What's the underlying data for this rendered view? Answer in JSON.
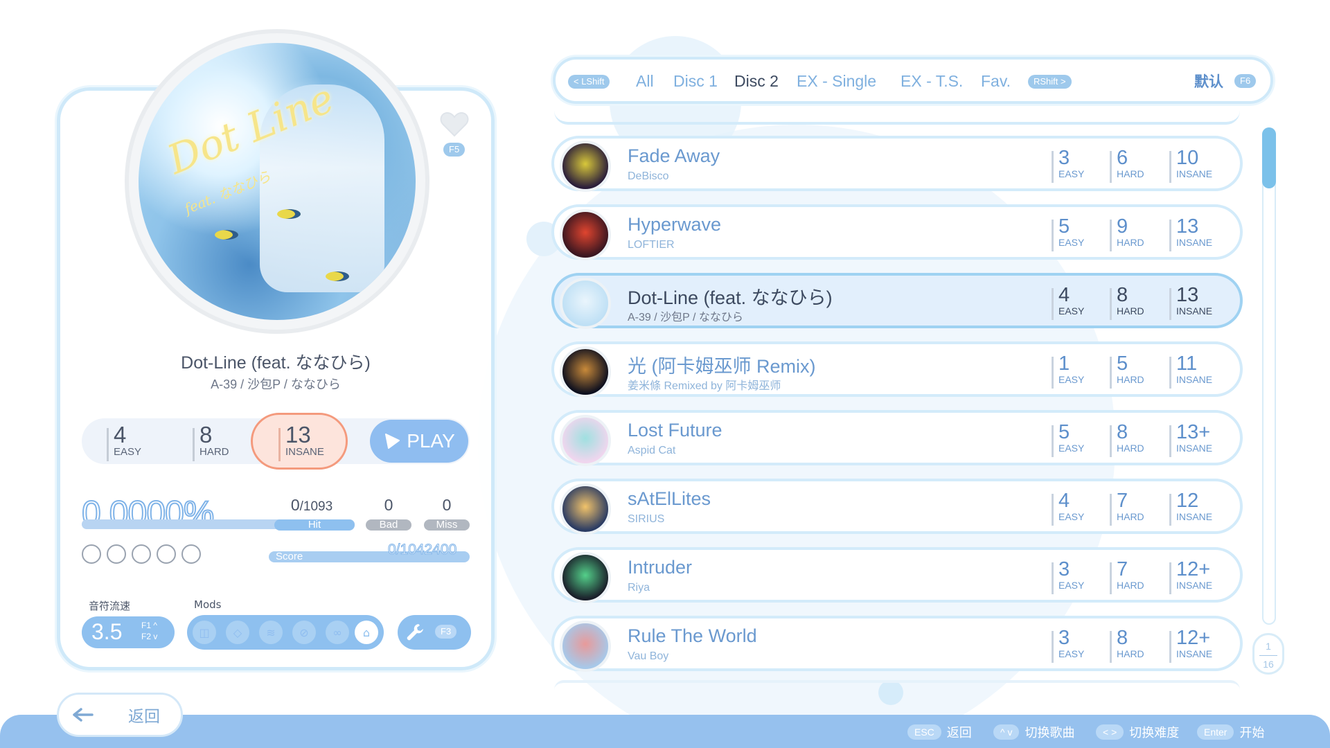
{
  "nav": {
    "prev_key": "< LShift",
    "next_key": "RShift >",
    "tabs": [
      {
        "label": "All",
        "active": false
      },
      {
        "label": "Disc 1",
        "active": false
      },
      {
        "label": "Disc 2",
        "active": true
      },
      {
        "label": "EX - Single",
        "active": false
      },
      {
        "label": "EX - T.S.",
        "active": false
      },
      {
        "label": "Fav.",
        "active": false
      }
    ],
    "sort_label": "默认",
    "sort_key": "F6"
  },
  "detail": {
    "favorite_key": "F5",
    "title": "Dot-Line (feat. ななひら)",
    "artist": "A-39 / 沙包P / ななひら",
    "cover_text": "Dot Line",
    "cover_sub": "feat. ななひら",
    "difficulties": [
      {
        "level": "4",
        "name": "EASY"
      },
      {
        "level": "8",
        "name": "HARD"
      },
      {
        "level": "13",
        "name": "INSANE"
      }
    ],
    "selected_difficulty": "INSANE",
    "play_label": "PLAY",
    "accuracy": "0.0000%",
    "hit_value": "0",
    "hit_total": "/1093",
    "hit_label": "Hit",
    "bad_value": "0",
    "bad_label": "Bad",
    "miss_value": "0",
    "miss_label": "Miss",
    "score_label": "Score",
    "score_value": "0/1042400",
    "rating_circles": 5,
    "speed_label": "音符流速",
    "speed_value": "3.5",
    "speed_up_key": "F1 ^",
    "speed_down_key": "F2 v",
    "mods_label": "Mods",
    "settings_key": "F3"
  },
  "songs": [
    {
      "title": "Fade Away",
      "artist": "DeBisco",
      "easy": "3",
      "hard": "6",
      "insane": "10",
      "selected": false,
      "cover": [
        "#2a1d3a",
        "#d8c83a"
      ]
    },
    {
      "title": "Hyperwave",
      "artist": "LOFTIER",
      "easy": "5",
      "hard": "9",
      "insane": "13",
      "selected": false,
      "cover": [
        "#3a1620",
        "#e0452f"
      ]
    },
    {
      "title": "Dot-Line (feat. ななひら)",
      "artist": "A-39 / 沙包P / ななひら",
      "easy": "4",
      "hard": "8",
      "insane": "13",
      "selected": true,
      "cover": [
        "#bfe0f5",
        "#eaf5fc"
      ]
    },
    {
      "title": "光 (阿卡姆巫师 Remix)",
      "artist": "姜米條 Remixed by 阿卡姆巫师",
      "easy": "1",
      "hard": "5",
      "insane": "11",
      "selected": false,
      "cover": [
        "#0d0f1e",
        "#c98a3a"
      ]
    },
    {
      "title": "Lost Future",
      "artist": "Aspid Cat",
      "easy": "5",
      "hard": "8",
      "insane": "13+",
      "selected": false,
      "cover": [
        "#f0d6ee",
        "#9fe0e0"
      ]
    },
    {
      "title": "sAtElLites",
      "artist": "SIRIUS",
      "easy": "4",
      "hard": "7",
      "insane": "12",
      "selected": false,
      "cover": [
        "#2a3b63",
        "#f2c36a"
      ]
    },
    {
      "title": "Intruder",
      "artist": "Riya",
      "easy": "3",
      "hard": "7",
      "insane": "12+",
      "selected": false,
      "cover": [
        "#1a1f2a",
        "#54d08a"
      ]
    },
    {
      "title": "Rule The World",
      "artist": "Vau Boy",
      "easy": "3",
      "hard": "8",
      "insane": "12+",
      "selected": false,
      "cover": [
        "#a7c8e9",
        "#e89a9a"
      ]
    }
  ],
  "diff_labels": {
    "easy": "EASY",
    "hard": "HARD",
    "insane": "INSANE"
  },
  "page": {
    "current": "1",
    "total": "16"
  },
  "footer": {
    "back_label": "返回",
    "hints": [
      {
        "key": "ESC",
        "label": "返回"
      },
      {
        "key": "^ v",
        "label": "切换歌曲"
      },
      {
        "key": "< >",
        "label": "切换难度"
      },
      {
        "key": "Enter",
        "label": "开始"
      }
    ]
  },
  "colors": {
    "accent": "#8ec0ef",
    "selected_border": "#f49a7d",
    "panel_border": "#cfe9f9",
    "text_blue": "#6a99cf"
  }
}
